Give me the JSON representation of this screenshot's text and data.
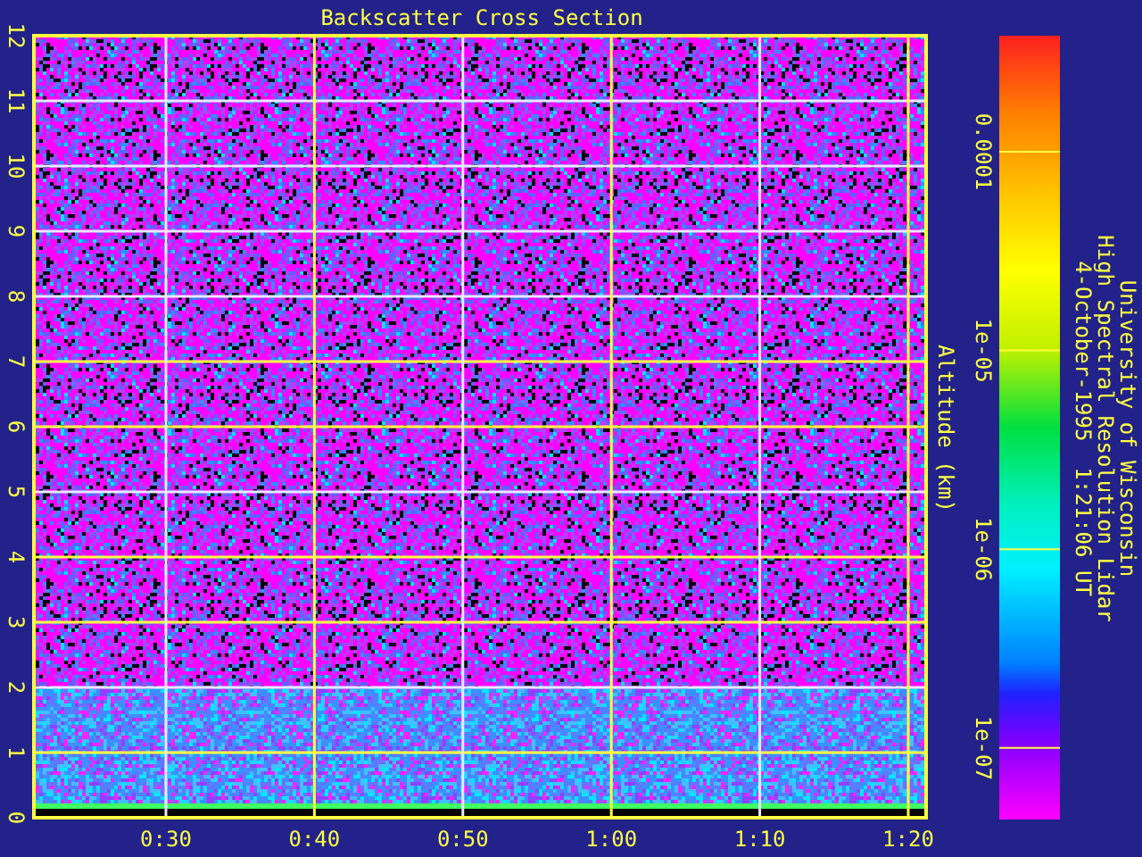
{
  "title": "Backscatter Cross Section",
  "y_axis": {
    "label": "Altitude (km)",
    "ticks": [
      "0",
      "1",
      "2",
      "3",
      "4",
      "5",
      "6",
      "7",
      "8",
      "9",
      "10",
      "11",
      "12"
    ]
  },
  "x_axis": {
    "ticks": [
      "0:30",
      "0:40",
      "0:50",
      "1:00",
      "1:10",
      "1:20"
    ]
  },
  "colorbar": {
    "ticks": [
      "0.0001",
      "1e-05",
      "1e-06",
      "1e-07"
    ]
  },
  "caption": [
    "University of Wisconsin",
    "High Spectral Resolution Lidar",
    "4-October-1995  1:21:06 UT"
  ]
}
